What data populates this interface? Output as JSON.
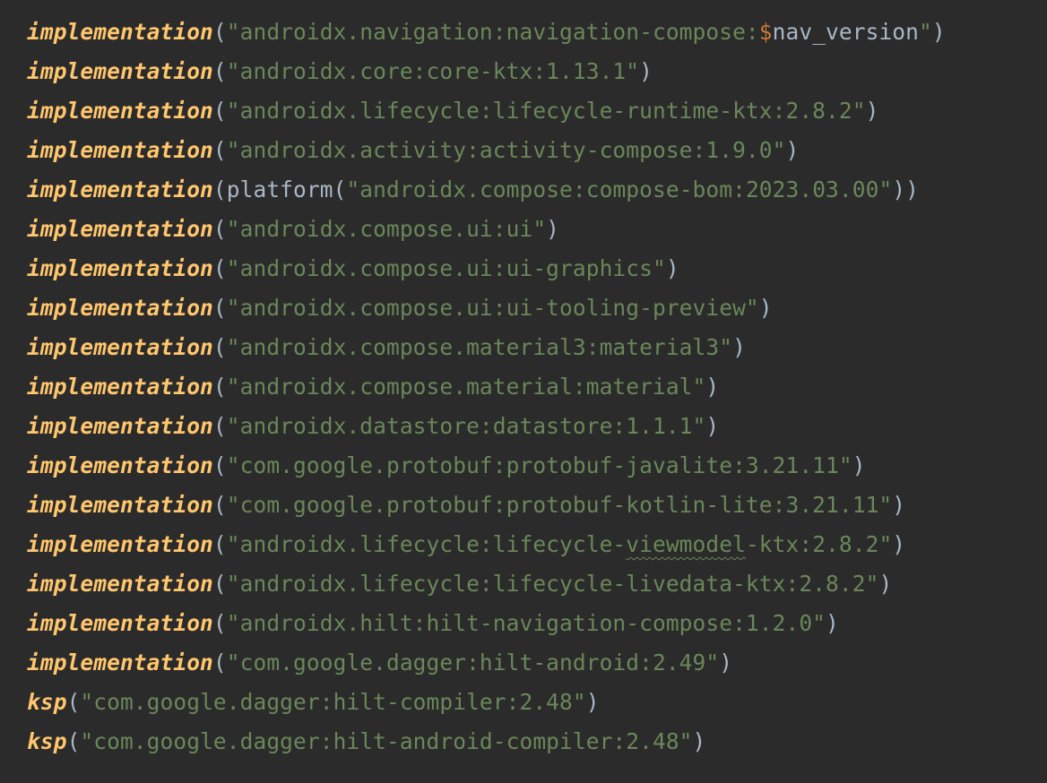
{
  "colors": {
    "background": "#2b2b2b",
    "function": "#ffc66d",
    "string": "#6a8759",
    "punctuation": "#a9b7c6",
    "template_dollar": "#cc7832"
  },
  "lines": [
    {
      "fn": "implementation",
      "str_before": "\"androidx.navigation:navigation-compose:",
      "dollar": "$",
      "var": "nav_version",
      "str_after": "\"",
      "close": ")"
    },
    {
      "fn": "implementation",
      "str": "\"androidx.core:core-ktx:1.13.1\"",
      "close": ")"
    },
    {
      "fn": "implementation",
      "str": "\"androidx.lifecycle:lifecycle-runtime-ktx:2.8.2\"",
      "close": ")"
    },
    {
      "fn": "implementation",
      "str": "\"androidx.activity:activity-compose:1.9.0\"",
      "close": ")"
    },
    {
      "fn": "implementation",
      "inner_fn": "platform",
      "str": "\"androidx.compose:compose-bom:2023.03.00\"",
      "close": "))"
    },
    {
      "fn": "implementation",
      "str": "\"androidx.compose.ui:ui\"",
      "close": ")"
    },
    {
      "fn": "implementation",
      "str": "\"androidx.compose.ui:ui-graphics\"",
      "close": ")"
    },
    {
      "fn": "implementation",
      "str": "\"androidx.compose.ui:ui-tooling-preview\"",
      "close": ")"
    },
    {
      "fn": "implementation",
      "str": "\"androidx.compose.material3:material3\"",
      "close": ")"
    },
    {
      "fn": "implementation",
      "str": "\"androidx.compose.material:material\"",
      "close": ")"
    },
    {
      "fn": "implementation",
      "str": "\"androidx.datastore:datastore:1.1.1\"",
      "close": ")"
    },
    {
      "fn": "implementation",
      "str": "\"com.google.protobuf:protobuf-javalite:3.21.11\"",
      "close": ")"
    },
    {
      "fn": "implementation",
      "str": "\"com.google.protobuf:protobuf-kotlin-lite:3.21.11\"",
      "close": ")"
    },
    {
      "fn": "implementation",
      "str_before": "\"androidx.lifecycle:lifecycle-",
      "typo": "viewmodel",
      "str_after": "-ktx:2.8.2\"",
      "close": ")"
    },
    {
      "fn": "implementation",
      "str": "\"androidx.lifecycle:lifecycle-livedata-ktx:2.8.2\"",
      "close": ")"
    },
    {
      "fn": "implementation",
      "str": "\"androidx.hilt:hilt-navigation-compose:1.2.0\"",
      "close": ")"
    },
    {
      "fn": "implementation",
      "str": "\"com.google.dagger:hilt-android:2.49\"",
      "close": ")"
    },
    {
      "fn": "ksp",
      "str": "\"com.google.dagger:hilt-compiler:2.48\"",
      "close": ")"
    },
    {
      "fn": "ksp",
      "str": "\"com.google.dagger:hilt-android-compiler:2.48\"",
      "close": ")"
    }
  ]
}
